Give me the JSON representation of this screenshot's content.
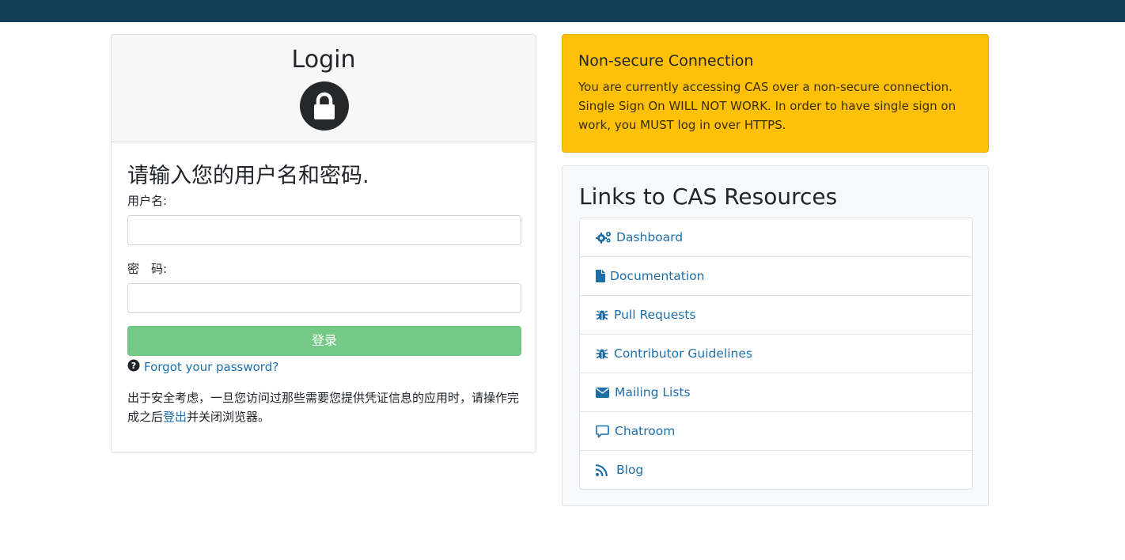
{
  "login": {
    "title": "Login",
    "prompt": "请输入您的用户名和密码.",
    "username_label": "用户名:",
    "username_value": "",
    "password_label": "密　码:",
    "password_value": "",
    "submit_label": "登录",
    "forgot_label": "Forgot your password?",
    "notice_part1": "出于安全考虑，一旦您访问过那些需要您提供凭证信息的应用时，请操作完成之后",
    "notice_link": "登出",
    "notice_part2": "并关闭浏览器。"
  },
  "warning": {
    "title": "Non-secure Connection",
    "body": "You are currently accessing CAS over a non-secure connection. Single Sign On WILL NOT WORK. In order to have single sign on work, you MUST log in over HTTPS."
  },
  "resources": {
    "title": "Links to CAS Resources",
    "items": [
      {
        "label": "Dashboard",
        "icon": "gears-icon"
      },
      {
        "label": "Documentation",
        "icon": "file-icon"
      },
      {
        "label": "Pull Requests",
        "icon": "bug-icon"
      },
      {
        "label": "Contributor Guidelines",
        "icon": "bug-icon"
      },
      {
        "label": "Mailing Lists",
        "icon": "envelope-icon"
      },
      {
        "label": "Chatroom",
        "icon": "comment-icon"
      },
      {
        "label": "Blog",
        "icon": "rss-icon"
      }
    ]
  },
  "colors": {
    "topbar": "#153d53",
    "warning": "#ffc107",
    "button": "#75c986",
    "link": "#1e6fa8"
  }
}
